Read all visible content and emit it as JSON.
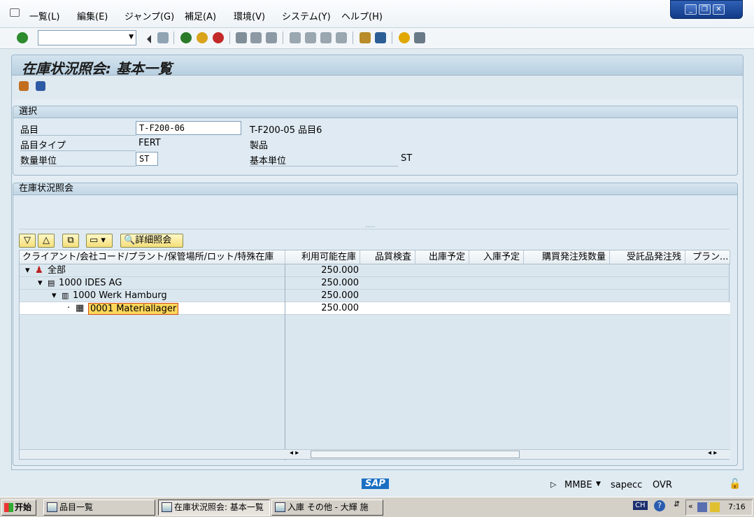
{
  "menu": {
    "items": [
      "一覧(L)",
      "編集(E)",
      "ジャンプ(G)",
      "補足(A)",
      "環境(V)",
      "システム(Y)",
      "ヘルプ(H)"
    ]
  },
  "window_controls": {
    "minimize": "_",
    "restore": "❐",
    "close": "✕"
  },
  "toolbar": {
    "command_field_value": ""
  },
  "page": {
    "title": "在庫状況照会: 基本一覧"
  },
  "selection": {
    "header": "選択",
    "material_label": "品目",
    "material_value": "T-F200-06",
    "material_desc": "T-F200-05  品目6",
    "material_type_label": "品目タイプ",
    "material_type_value": "FERT",
    "material_type_desc": "製品",
    "qty_unit_label": "数量単位",
    "qty_unit_value": "ST",
    "base_unit_label": "基本単位",
    "base_unit_value": "ST"
  },
  "stock": {
    "header": "在庫状況照会",
    "detail_button": "詳細照会",
    "columns": [
      "クライアント/会社コード/プラント/保管場所/ロット/特殊在庫",
      "利用可能在庫",
      "品質検査",
      "出庫予定",
      "入庫予定",
      "購買発注残数量",
      "受託品発注残",
      "プラン..."
    ],
    "rows": [
      {
        "label": "全部",
        "available": "250.000",
        "level": 0
      },
      {
        "label": "1000 IDES AG",
        "available": "250.000",
        "level": 1
      },
      {
        "label": "1000 Werk Hamburg",
        "available": "250.000",
        "level": 2
      },
      {
        "label": "0001 Materiallager",
        "available": "250.000",
        "level": 3
      }
    ]
  },
  "status": {
    "sap_logo": "SAP",
    "transaction": "MMBE",
    "server": "sapecc",
    "mode": "OVR"
  },
  "taskbar": {
    "start": "开始",
    "tasks": [
      "品目一覧",
      "在庫状況照会: 基本一覧",
      "入庫 その他 - 大輝 施"
    ],
    "lang": "CH",
    "time": "7:16"
  }
}
